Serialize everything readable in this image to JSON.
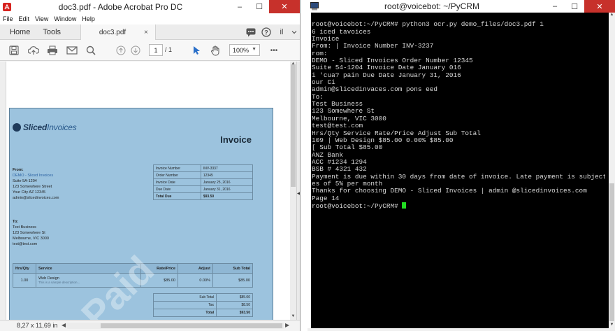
{
  "acrobat": {
    "title": "doc3.pdf - Adobe Acrobat Pro DC",
    "menu": [
      "File",
      "Edit",
      "View",
      "Window",
      "Help"
    ],
    "tab_home": "Home",
    "tab_tools": "Tools",
    "doc_tab": "doc3.pdf",
    "doc_tab_close": "×",
    "page_current": "1",
    "page_total": "/ 1",
    "zoom": "100%",
    "doc_size": "8,27 x 11,69 in",
    "more_icon": "•••",
    "account_initials": "il"
  },
  "invoice": {
    "logo_strong": "Sliced",
    "logo_light": "Invoices",
    "title": "Invoice",
    "from_label": "From:",
    "from_name": "DEMO - Sliced Invoices",
    "from_lines": [
      "Suite 5A-1204",
      "123 Somewhere Street",
      "Your City AZ 12345",
      "admin@slicedinvoices.com"
    ],
    "to_label": "To:",
    "to_lines": [
      "Test Business",
      "123 Somewhere St",
      "Melbourne, VIC 3000",
      "test@test.com"
    ],
    "meta": [
      {
        "k": "Invoice Number",
        "v": "INV-3337"
      },
      {
        "k": "Order Number",
        "v": "12345"
      },
      {
        "k": "Invoice Date",
        "v": "January 25, 2016"
      },
      {
        "k": "Due Date",
        "v": "January 31, 2016"
      },
      {
        "k": "Total Due",
        "v": "$93.50"
      }
    ],
    "item_headers": {
      "qty": "Hrs/Qty",
      "service": "Service",
      "rate": "Rate/Price",
      "adjust": "Adjust",
      "subtotal": "Sub Total"
    },
    "item": {
      "qty": "1.00",
      "service": "Web Design",
      "desc": "This is a sample description...",
      "rate": "$85.00",
      "adjust": "0.00%",
      "subtotal": "$85.00"
    },
    "totals": [
      {
        "k": "Sub Total",
        "v": "$85.00"
      },
      {
        "k": "Tax",
        "v": "$8.50"
      },
      {
        "k": "Total",
        "v": "$93.50"
      }
    ],
    "watermark": "Paid"
  },
  "terminal": {
    "title": "root@voicebot: ~/PyCRM",
    "lines": [
      "root@voicebot:~/PyCRM# python3 ocr.py demo_files/doc3.pdf 1",
      "6 iced tavoices",
      "Invoice",
      "From: | Invoice Number INV-3237",
      "rom:",
      "DEMO - Sliced Invoices Order Number 12345",
      "Suite 54-1204 Invoice Date January 016",
      "i 'cua? pain Due Date January 31, 2016",
      "our Ci",
      "admin@slicedinvaces.com pons eed",
      "To:",
      "Test Business",
      "123 Somewhere St",
      "Melbourne, VIC 3000",
      "test@test.com",
      "Hrs/Qty Service Rate/Price Adjust Sub Total",
      "109 | Web Design $85.00 0.00% $85.00",
      "[ Sub Total $85.00",
      "ANZ Bank",
      "ACC #1234 1294",
      "BSB # 4321 432",
      "Payment is due within 30 days from date of invoice. Late payment is subject to fe",
      "es of 5% per month",
      "Thanks for choosing DEMO - Sliced Invoices | admin @slicedinvoices.com",
      "Page 14"
    ],
    "prompt": "root@voicebot:~/PyCRM# "
  },
  "window_controls": {
    "minimize": "–",
    "maximize": "☐",
    "close": "✕"
  }
}
